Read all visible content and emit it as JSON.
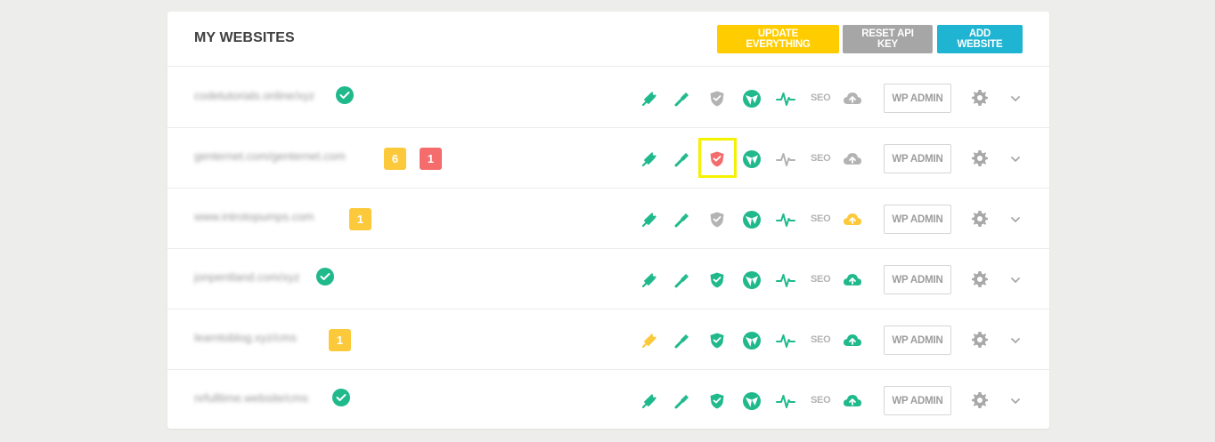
{
  "panel": {
    "title": "MY WEBSITES",
    "buttons": {
      "update_everything": "UPDATE EVERYTHING",
      "reset_api_key": "RESET API KEY",
      "add_website": "ADD WEBSITE"
    }
  },
  "colors": {
    "green": "#1fb98c",
    "gray": "#b3b3b3",
    "yellow": "#fcc93b",
    "red": "#f46c6c",
    "highlight": "#f5f200"
  },
  "icon_names": [
    "plugins-icon",
    "themes-icon",
    "security-shield-icon",
    "wordpress-core-icon",
    "uptime-pulse-icon",
    "seo-icon",
    "backup-cloud-icon"
  ],
  "sites": [
    {
      "url": "codetutorials.online/xyz",
      "status": "ok",
      "badges": [],
      "plugins": "green",
      "themes": "green",
      "security": "gray",
      "core": "green",
      "uptime": "green",
      "backup": "gray"
    },
    {
      "url": "genternet.com/genternet.com",
      "status": "",
      "badges": [
        {
          "value": "6",
          "color": "yellow"
        },
        {
          "value": "1",
          "color": "red"
        }
      ],
      "plugins": "green",
      "themes": "green",
      "security": "red",
      "core": "green",
      "uptime": "gray",
      "backup": "gray"
    },
    {
      "url": "www.introtopumps.com",
      "status": "",
      "badges": [
        {
          "value": "1",
          "color": "yellow"
        }
      ],
      "plugins": "green",
      "themes": "green",
      "security": "gray",
      "core": "green",
      "uptime": "green",
      "backup": "yellow"
    },
    {
      "url": "jonpentland.com/xyz",
      "status": "ok",
      "badges": [],
      "plugins": "green",
      "themes": "green",
      "security": "green",
      "core": "green",
      "uptime": "green",
      "backup": "green"
    },
    {
      "url": "learntoblog.xyz/cms",
      "status": "",
      "badges": [
        {
          "value": "1",
          "color": "yellow"
        }
      ],
      "plugins": "yellow",
      "themes": "green",
      "security": "green",
      "core": "green",
      "uptime": "green",
      "backup": "green"
    },
    {
      "url": "nrfulltime.website/cms",
      "status": "ok",
      "badges": [],
      "plugins": "green",
      "themes": "green",
      "security": "green",
      "core": "green",
      "uptime": "green",
      "backup": "green"
    }
  ],
  "row_labels": {
    "seo": "SEO",
    "wp_admin": "WP ADMIN"
  }
}
